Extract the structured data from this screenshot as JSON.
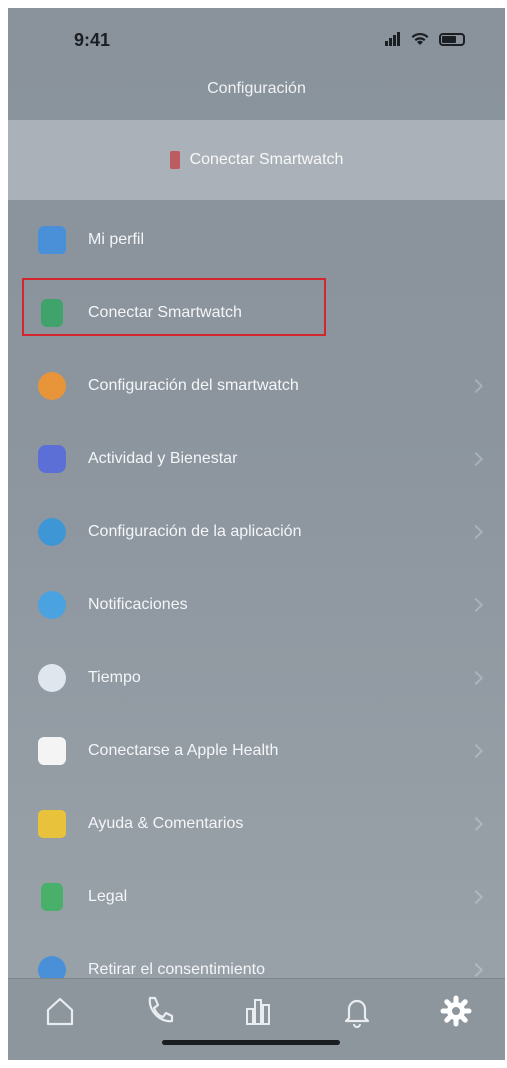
{
  "status_bar": {
    "time": "9:41"
  },
  "header": {
    "title": "Configuración"
  },
  "banner": {
    "label": "Conectar Smartwatch"
  },
  "menu": {
    "items": [
      {
        "label": "Mi perfil",
        "icon": "person-icon",
        "color": "#4a90d9"
      },
      {
        "label": "Conectar Smartwatch",
        "icon": "watch-icon",
        "color": "#3fa36b"
      },
      {
        "label": "Configuración del smartwatch",
        "icon": "gear-icon",
        "color": "#e8953a"
      },
      {
        "label": "Actividad y Bienestar",
        "icon": "heart-rate-icon",
        "color": "#5b6fd6"
      },
      {
        "label": "Configuración de la aplicación",
        "icon": "settings-icon",
        "color": "#3e97d4"
      },
      {
        "label": "Notificaciones",
        "icon": "bell-icon",
        "color": "#4aa3e0"
      },
      {
        "label": "Tiempo",
        "icon": "weather-icon",
        "color": "#dfe6ee"
      },
      {
        "label": "Conectarse a Apple Health",
        "icon": "health-icon",
        "color": "#f4f4f4"
      },
      {
        "label": "Ayuda & Comentarios",
        "icon": "help-icon",
        "color": "#e8c23a"
      },
      {
        "label": "Legal",
        "icon": "lock-icon",
        "color": "#48b06a"
      },
      {
        "label": "Retirar el consentimiento",
        "icon": "consent-icon",
        "color": "#4a90d9"
      }
    ]
  },
  "tabbar": {
    "tabs": [
      {
        "icon": "home-icon"
      },
      {
        "icon": "phone-icon"
      },
      {
        "icon": "stats-icon"
      },
      {
        "icon": "bell-icon"
      },
      {
        "icon": "gear-icon",
        "active": true
      }
    ]
  }
}
